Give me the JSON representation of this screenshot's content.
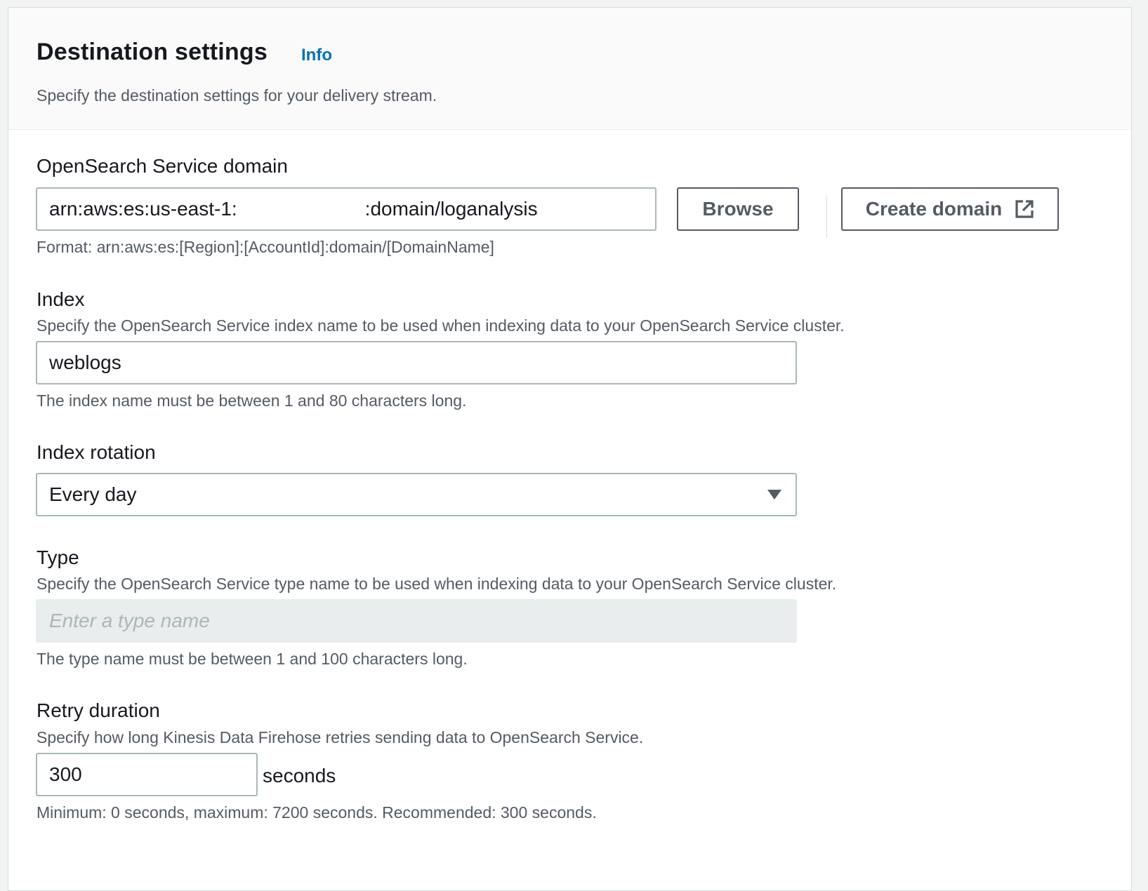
{
  "header": {
    "title": "Destination settings",
    "info_label": "Info",
    "description": "Specify the destination settings for your delivery stream."
  },
  "domain": {
    "label": "OpenSearch Service domain",
    "value_prefix": "arn:aws:es:us-east-1:",
    "value_suffix": ":domain/loganalysis",
    "browse_label": "Browse",
    "create_label": "Create domain",
    "hint": "Format: arn:aws:es:[Region]:[AccountId]:domain/[DomainName]"
  },
  "index": {
    "label": "Index",
    "description": "Specify the OpenSearch Service index name to be used when indexing data to your OpenSearch Service cluster.",
    "value": "weblogs",
    "hint": "The index name must be between 1 and 80 characters long."
  },
  "rotation": {
    "label": "Index rotation",
    "value": "Every day"
  },
  "type": {
    "label": "Type",
    "description": "Specify the OpenSearch Service type name to be used when indexing data to your OpenSearch Service cluster.",
    "placeholder": "Enter a type name",
    "hint": "The type name must be between 1 and 100 characters long."
  },
  "retry": {
    "label": "Retry duration",
    "description": "Specify how long Kinesis Data Firehose retries sending data to OpenSearch Service.",
    "value": "300",
    "unit": "seconds",
    "hint": "Minimum: 0 seconds, maximum: 7200 seconds. Recommended: 300 seconds."
  },
  "icons": {
    "external": "external-link-icon",
    "caret": "caret-down-icon"
  }
}
